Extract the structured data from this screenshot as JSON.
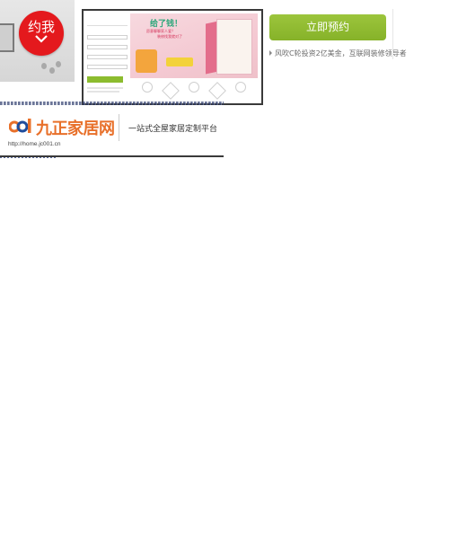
{
  "promo": {
    "badge_text": "约我"
  },
  "screenshot": {
    "banner_title": "给了钱！",
    "banner_sub1": "愿意聊聊家人爱？",
    "banner_sub2": "装修找我就对了"
  },
  "cta": {
    "button_label": "立即预约"
  },
  "notice": {
    "text": "风吹C轮投资2亿美金，互联网装修领导者"
  },
  "site": {
    "logo_text": "九正家居网",
    "tagline": "一站式全屋家居定制平台",
    "url": "http://home.jc001.cn"
  },
  "colors": {
    "accent_green": "#8cbc2e",
    "badge_red": "#e4191d",
    "logo_orange": "#e8702a"
  }
}
